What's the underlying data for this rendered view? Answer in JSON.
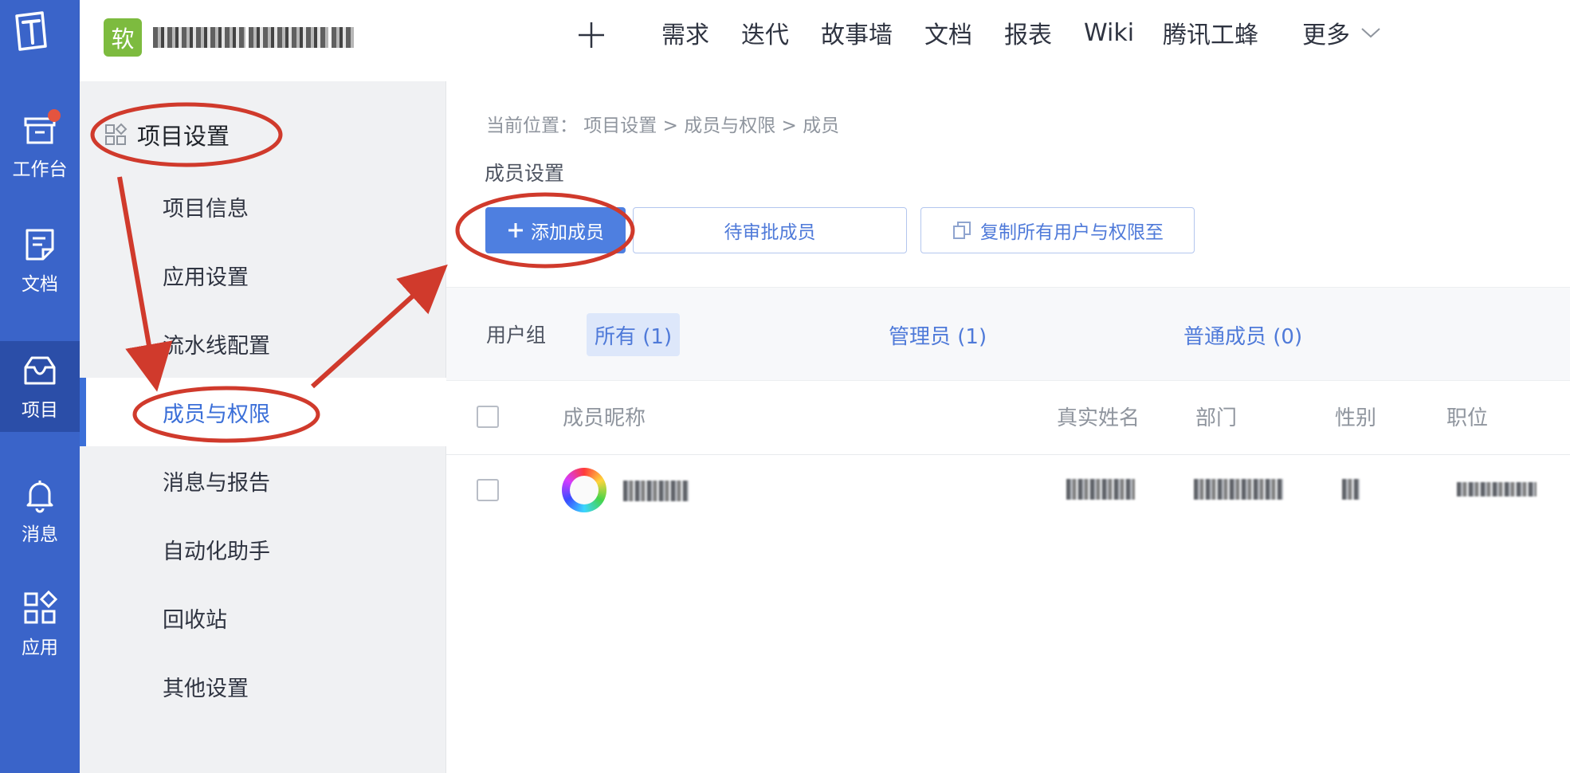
{
  "colors": {
    "rail_bg": "#3a64c9",
    "rail_active": "#2b4ea8",
    "primary": "#4e7fe0",
    "link_blue": "#4f7ad9",
    "annotation_red": "#d03a2c",
    "project_badge": "#7dbb3f"
  },
  "rail": {
    "items": [
      {
        "label": "工作台",
        "icon": "inbox-icon",
        "notification": true
      },
      {
        "label": "文档",
        "icon": "document-icon"
      },
      {
        "label": "项目",
        "icon": "project-box-icon",
        "active": true
      },
      {
        "label": "消息",
        "icon": "bell-icon"
      },
      {
        "label": "应用",
        "icon": "apps-grid-icon"
      }
    ]
  },
  "topbar": {
    "project_badge": "软",
    "nav": [
      "需求",
      "迭代",
      "故事墙",
      "文档",
      "报表",
      "Wiki",
      "腾讯工蜂",
      "更多"
    ]
  },
  "sidebar": {
    "heading": "项目设置",
    "items": [
      {
        "label": "项目信息"
      },
      {
        "label": "应用设置"
      },
      {
        "label": "流水线配置"
      },
      {
        "label": "成员与权限",
        "active": true
      },
      {
        "label": "消息与报告"
      },
      {
        "label": "自动化助手"
      },
      {
        "label": "回收站"
      },
      {
        "label": "其他设置"
      }
    ]
  },
  "main": {
    "breadcrumb": "当前位置： 项目设置 > 成员与权限 > 成员",
    "section_title": "成员设置",
    "buttons": {
      "add_member": "添加成员",
      "pending": "待审批成员",
      "copy_all": "复制所有用户与权限至"
    },
    "filter": {
      "label": "用户组",
      "tabs": [
        {
          "label": "所有 (1)",
          "active": true
        },
        {
          "label": "管理员 (1)"
        },
        {
          "label": "普通成员 (0)"
        }
      ]
    },
    "table": {
      "columns": [
        "成员昵称",
        "真实姓名",
        "部门",
        "性别",
        "职位"
      ],
      "rows": 1
    }
  }
}
